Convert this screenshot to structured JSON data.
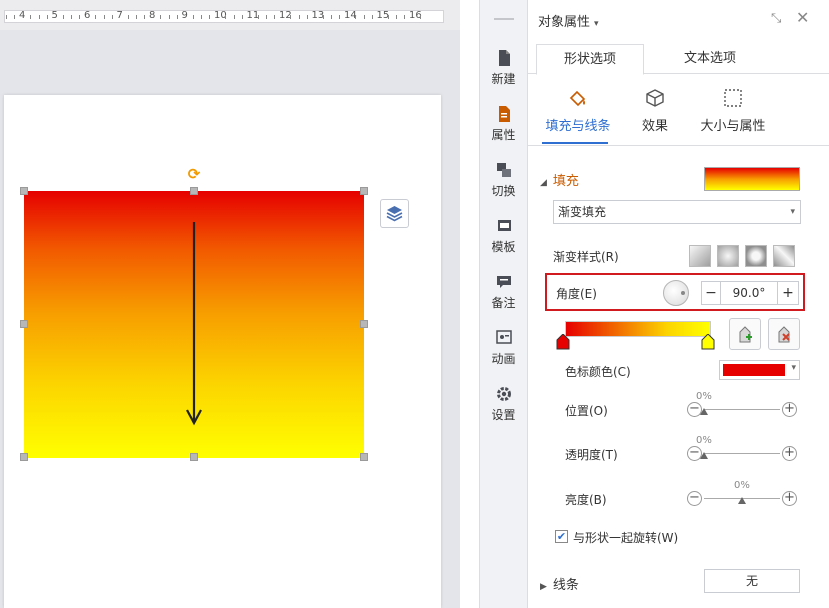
{
  "ruler": {
    "numbers": [
      "4",
      "5",
      "6",
      "7",
      "8",
      "9",
      "10",
      "11",
      "12",
      "13",
      "14",
      "15",
      "16"
    ]
  },
  "sidebar": {
    "items": [
      {
        "label": "新建",
        "icon": "new-document-icon"
      },
      {
        "label": "属性",
        "icon": "properties-icon"
      },
      {
        "label": "切换",
        "icon": "transition-icon"
      },
      {
        "label": "模板",
        "icon": "template-icon"
      },
      {
        "label": "备注",
        "icon": "note-icon"
      },
      {
        "label": "动画",
        "icon": "animation-icon"
      },
      {
        "label": "设置",
        "icon": "gear-icon"
      }
    ]
  },
  "panel": {
    "title": "对象属性",
    "title_arrow": "▾",
    "tabs": {
      "shape": "形状选项",
      "text": "文本选项"
    },
    "subtabs": {
      "fill_line": "填充与线条",
      "effect": "效果",
      "size": "大小与属性"
    },
    "fill": {
      "header": "填充",
      "type": "渐变填充",
      "gradient_style_label": "渐变样式(R)",
      "angle_label": "角度(E)",
      "angle_value": "90.0°",
      "minus": "−",
      "plus": "+",
      "stop_color_label": "色标颜色(C)",
      "stop_color": "#e60000",
      "position": {
        "label": "位置(O)",
        "value": "0%",
        "fraction": 0.0
      },
      "transparency": {
        "label": "透明度(T)",
        "value": "0%",
        "fraction": 0.0
      },
      "brightness": {
        "label": "亮度(B)",
        "value": "0%",
        "fraction": 0.5
      },
      "rotate_with_shape": "与形状一起旋转(W)",
      "rotate_checked": true
    },
    "line": {
      "header": "线条",
      "value": "无"
    }
  },
  "colors": {
    "gradient_top": "#e60000",
    "gradient_bottom": "#ffff00",
    "accent": "#2e6fd1",
    "highlight_box": "#d01a1f"
  }
}
